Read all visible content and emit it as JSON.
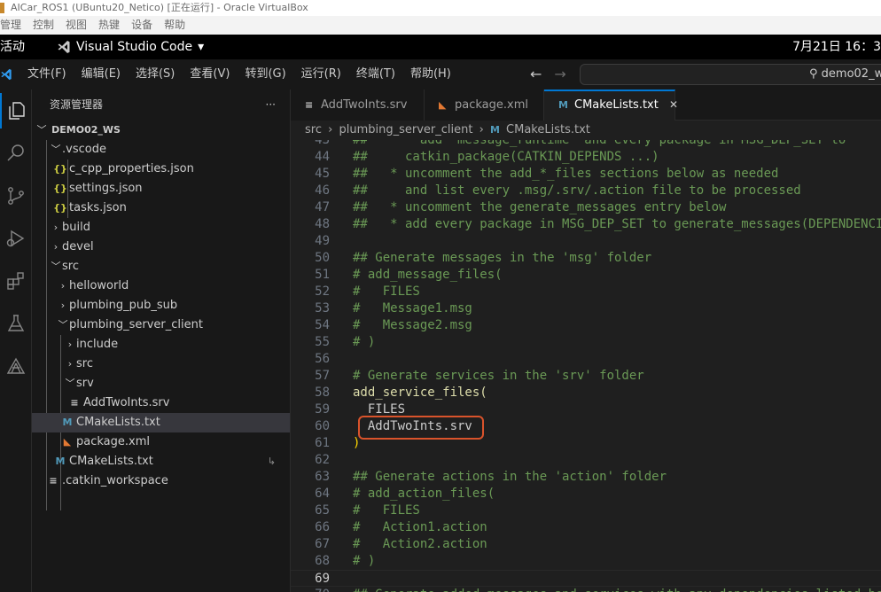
{
  "host_window": {
    "title": "AICar_ROS1 (UBuntu20_Netico) [正在运行] - Oracle VirtualBox",
    "menu": [
      "管理",
      "控制",
      "视图",
      "热键",
      "设备",
      "帮助"
    ]
  },
  "gnome_bar": {
    "activities": "活动",
    "app_name": "Visual Studio Code",
    "app_dropdown": "▾",
    "clock": "7月21日  16：3"
  },
  "vscode_title": {
    "menus": [
      "文件(F)",
      "编辑(E)",
      "选择(S)",
      "查看(V)",
      "转到(G)",
      "运行(R)",
      "终端(T)",
      "帮助(H)"
    ],
    "back": "←",
    "forward": "→",
    "search_text": "demo02_w",
    "search_icon": "⚲"
  },
  "activity_bar": {
    "items": [
      "explorer-icon",
      "search-icon",
      "source-control-icon",
      "run-debug-icon",
      "extensions-icon",
      "testing-icon",
      "ros-icon"
    ]
  },
  "explorer": {
    "header": "资源管理器",
    "more": "···",
    "workspace": "DEMO02_WS",
    "tree": [
      {
        "label": ".vscode",
        "chevron": "﹀",
        "icon": "",
        "icon_color": ""
      },
      {
        "label": "c_cpp_properties.json",
        "chevron": "",
        "icon": "{}",
        "icon_color": "#cbcb41"
      },
      {
        "label": "settings.json",
        "chevron": "",
        "icon": "{}",
        "icon_color": "#cbcb41"
      },
      {
        "label": "tasks.json",
        "chevron": "",
        "icon": "{}",
        "icon_color": "#cbcb41"
      },
      {
        "label": "build",
        "chevron": "›",
        "icon": "",
        "icon_color": ""
      },
      {
        "label": "devel",
        "chevron": "›",
        "icon": "",
        "icon_color": ""
      },
      {
        "label": "src",
        "chevron": "﹀",
        "icon": "",
        "icon_color": ""
      },
      {
        "label": "helloworld",
        "chevron": "›",
        "icon": "",
        "icon_color": ""
      },
      {
        "label": "plumbing_pub_sub",
        "chevron": "›",
        "icon": "",
        "icon_color": ""
      },
      {
        "label": "plumbing_server_client",
        "chevron": "﹀",
        "icon": "",
        "icon_color": ""
      },
      {
        "label": "include",
        "chevron": "›",
        "icon": "",
        "icon_color": ""
      },
      {
        "label": "src",
        "chevron": "›",
        "icon": "",
        "icon_color": ""
      },
      {
        "label": "srv",
        "chevron": "﹀",
        "icon": "",
        "icon_color": ""
      },
      {
        "label": "AddTwoInts.srv",
        "chevron": "",
        "icon": "≡",
        "icon_color": "#cccccc"
      },
      {
        "label": "CMakeLists.txt",
        "chevron": "",
        "icon": "M",
        "icon_color": "#519aba"
      },
      {
        "label": "package.xml",
        "chevron": "",
        "icon": "◣",
        "icon_color": "#e37933"
      },
      {
        "label": "CMakeLists.txt",
        "chevron": "",
        "icon": "M",
        "icon_color": "#519aba"
      },
      {
        "label": ".catkin_workspace",
        "chevron": "",
        "icon": "≡",
        "icon_color": "#cccccc"
      }
    ],
    "symlink_marker": "↳"
  },
  "tabs": [
    {
      "label": "AddTwoInts.srv",
      "icon": "≡",
      "icon_color": "#cccccc"
    },
    {
      "label": "package.xml",
      "icon": "◣",
      "icon_color": "#e37933"
    },
    {
      "label": "CMakeLists.txt",
      "icon": "M",
      "icon_color": "#519aba",
      "close": "✕"
    }
  ],
  "breadcrumb": {
    "parts": [
      "src",
      "plumbing_server_client"
    ],
    "separator": "›",
    "file_icon": "M",
    "file": "CMakeLists.txt"
  },
  "editor": {
    "lines": [
      {
        "n": "43",
        "text": "##     * add \"message_runtime\" and every package in MSG_DEP_SET to",
        "kind": "comment"
      },
      {
        "n": "44",
        "text": "##     catkin_package(CATKIN_DEPENDS ...)",
        "kind": "comment"
      },
      {
        "n": "45",
        "text": "##   * uncomment the add_*_files sections below as needed",
        "kind": "comment"
      },
      {
        "n": "46",
        "text": "##     and list every .msg/.srv/.action file to be processed",
        "kind": "comment"
      },
      {
        "n": "47",
        "text": "##   * uncomment the generate_messages entry below",
        "kind": "comment"
      },
      {
        "n": "48",
        "text": "##   * add every package in MSG_DEP_SET to generate_messages(DEPENDENCIES ...)",
        "kind": "comment"
      },
      {
        "n": "49",
        "text": "",
        "kind": "plain"
      },
      {
        "n": "50",
        "text": "## Generate messages in the 'msg' folder",
        "kind": "comment"
      },
      {
        "n": "51",
        "text": "# add_message_files(",
        "kind": "comment"
      },
      {
        "n": "52",
        "text": "#   FILES",
        "kind": "comment"
      },
      {
        "n": "53",
        "text": "#   Message1.msg",
        "kind": "comment"
      },
      {
        "n": "54",
        "text": "#   Message2.msg",
        "kind": "comment"
      },
      {
        "n": "55",
        "text": "# )",
        "kind": "comment"
      },
      {
        "n": "56",
        "text": "",
        "kind": "plain"
      },
      {
        "n": "57",
        "text": "# Generate services in the 'srv' folder",
        "kind": "comment"
      },
      {
        "n": "58",
        "text": "add_service_files(",
        "kind": "func"
      },
      {
        "n": "59",
        "text": "  FILES",
        "kind": "plain"
      },
      {
        "n": "60",
        "text": "  AddTwoInts.srv",
        "kind": "plain"
      },
      {
        "n": "61",
        "text": ")",
        "kind": "paren"
      },
      {
        "n": "62",
        "text": "",
        "kind": "plain"
      },
      {
        "n": "63",
        "text": "## Generate actions in the 'action' folder",
        "kind": "comment"
      },
      {
        "n": "64",
        "text": "# add_action_files(",
        "kind": "comment"
      },
      {
        "n": "65",
        "text": "#   FILES",
        "kind": "comment"
      },
      {
        "n": "66",
        "text": "#   Action1.action",
        "kind": "comment"
      },
      {
        "n": "67",
        "text": "#   Action2.action",
        "kind": "comment"
      },
      {
        "n": "68",
        "text": "# )",
        "kind": "comment"
      },
      {
        "n": "69",
        "text": "",
        "kind": "plain"
      },
      {
        "n": "70",
        "text": "## Generate added messages and services with any dependencies listed here",
        "kind": "comment"
      }
    ],
    "current_line": "69",
    "highlighted_line": "60"
  }
}
